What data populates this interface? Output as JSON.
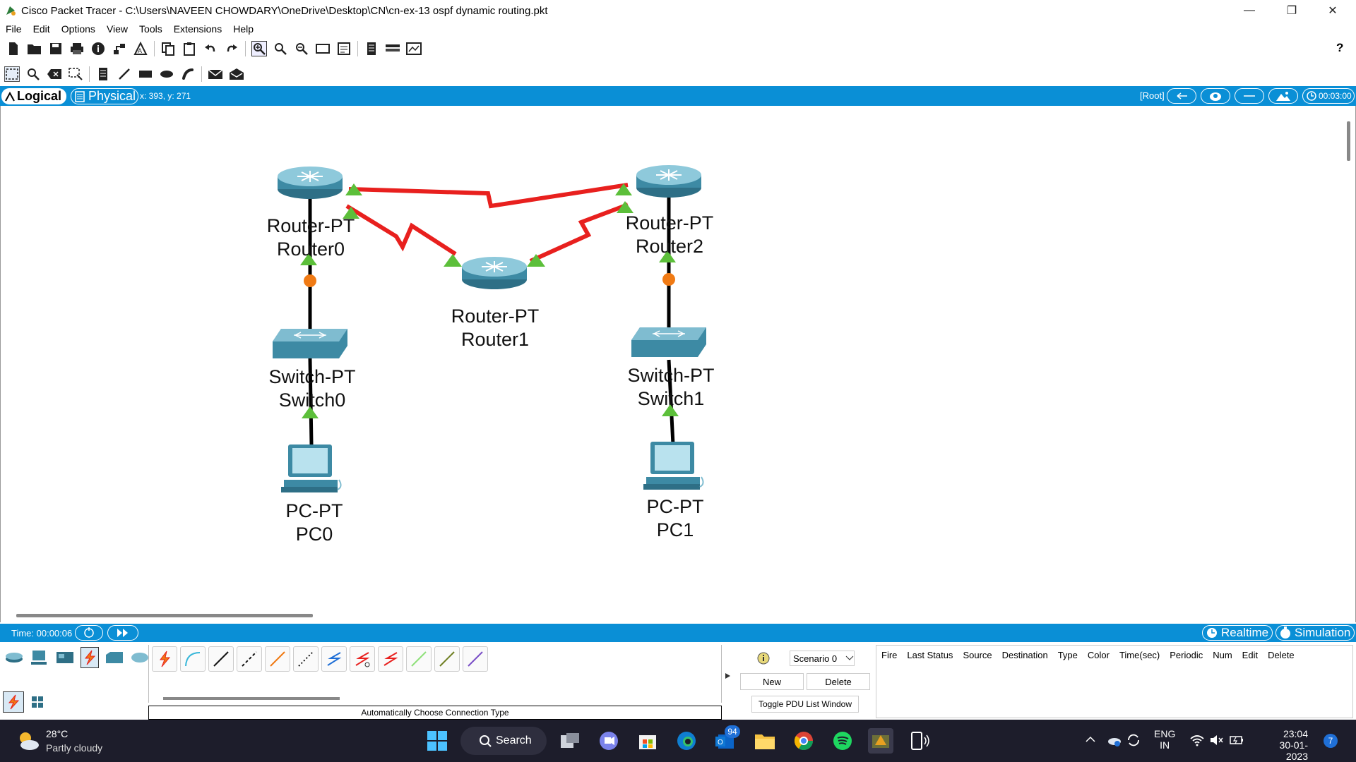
{
  "window": {
    "title": "Cisco Packet Tracer - C:\\Users\\NAVEEN CHOWDARY\\OneDrive\\Desktop\\CN\\cn-ex-13 ospf dynamic routing.pkt",
    "minimize": "—",
    "restore": "❐",
    "close": "✕"
  },
  "menu": [
    "File",
    "Edit",
    "Options",
    "View",
    "Tools",
    "Extensions",
    "Help"
  ],
  "help_glyph": "?",
  "viewbar": {
    "logical_label": "Logical",
    "physical_label": "Physical",
    "coords": "x: 393, y: 271",
    "root_label": "[Root]",
    "clock": "00:03:00"
  },
  "devices": [
    {
      "id": "router0",
      "type": "Router-PT",
      "name": "Router0"
    },
    {
      "id": "router1",
      "type": "Router-PT",
      "name": "Router1"
    },
    {
      "id": "router2",
      "type": "Router-PT",
      "name": "Router2"
    },
    {
      "id": "switch0",
      "type": "Switch-PT",
      "name": "Switch0"
    },
    {
      "id": "switch1",
      "type": "Switch-PT",
      "name": "Switch1"
    },
    {
      "id": "pc0",
      "type": "PC-PT",
      "name": "PC0"
    },
    {
      "id": "pc1",
      "type": "PC-PT",
      "name": "PC1"
    }
  ],
  "timebar": {
    "time": "Time: 00:00:06",
    "realtime": "Realtime",
    "simulation": "Simulation"
  },
  "connection_hint": "Automatically Choose Connection Type",
  "pdu": {
    "scenario": "Scenario 0",
    "new": "New",
    "delete": "Delete",
    "toggle": "Toggle PDU List Window",
    "columns": [
      "Fire",
      "Last Status",
      "Source",
      "Destination",
      "Type",
      "Color",
      "Time(sec)",
      "Periodic",
      "Num",
      "Edit",
      "Delete"
    ]
  },
  "taskbar": {
    "temperature": "28°C",
    "weather": "Partly cloudy",
    "search": "Search",
    "lang1": "ENG",
    "lang2": "IN",
    "time": "23:04",
    "date": "30-01-2023",
    "badge_teams": "94",
    "badge_notify": "7"
  },
  "colors": {
    "accent_blue": "#0a8fd6",
    "serial_link": "#e8201e",
    "link_up": "#5cbf3a",
    "link_orange": "#f07a14"
  }
}
